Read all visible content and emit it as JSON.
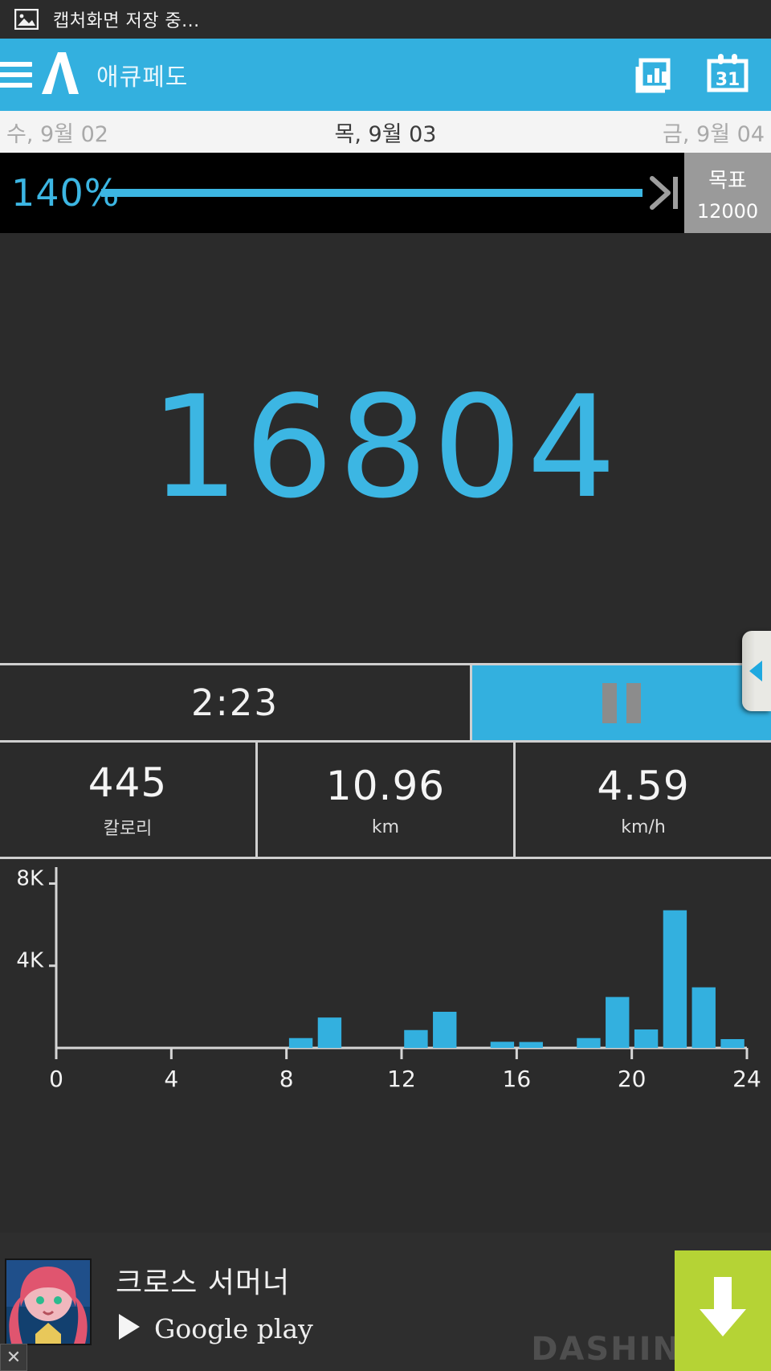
{
  "statusbar": {
    "text": "캡처화면 저장 중...",
    "icon": "image-icon"
  },
  "appbar": {
    "menu_icon": "hamburger-menu-icon",
    "logo": "accupedo-a-logo",
    "title": "애큐페도",
    "chart_icon": "bar-chart-history-icon",
    "calendar_icon": "calendar-icon",
    "calendar_day": "31",
    "accent_color": "#33b0df"
  },
  "dates": {
    "previous": "수, 9월 02",
    "current": "목, 9월 03",
    "next": "금, 9월 04"
  },
  "progress": {
    "percent_label": "140%",
    "percent_value": 140,
    "goal_label": "목표",
    "goal_value": "12000",
    "bar_color": "#3cb6e3",
    "bar_background": "#000000"
  },
  "hero": {
    "steps": "16804",
    "steps_color": "#3cb6e3"
  },
  "sidetab": {
    "icon": "expand-left-arrow-icon"
  },
  "timer": {
    "value": "2:23",
    "pause_icon": "pause-icon"
  },
  "stats": [
    {
      "value": "445",
      "label": "칼로리"
    },
    {
      "value": "10.96",
      "label": "km"
    },
    {
      "value": "4.59",
      "label": "km/h"
    }
  ],
  "chart_data": {
    "type": "bar",
    "title": "",
    "xlabel": "",
    "ylabel": "",
    "categories": [
      0,
      1,
      2,
      3,
      4,
      5,
      6,
      7,
      8,
      9,
      10,
      11,
      12,
      13,
      14,
      15,
      16,
      17,
      18,
      19,
      20,
      21,
      22,
      23
    ],
    "values": [
      0,
      0,
      0,
      0,
      0,
      0,
      0,
      0,
      480,
      1480,
      0,
      0,
      870,
      1760,
      0,
      300,
      290,
      0,
      480,
      2480,
      900,
      6700,
      2950,
      430
    ],
    "ytick_labels": [
      "4K",
      "8K"
    ],
    "ytick_values": [
      4000,
      8000
    ],
    "xtick_labels": [
      "0",
      "4",
      "8",
      "12",
      "16",
      "20",
      "24"
    ],
    "xtick_values": [
      0,
      4,
      8,
      12,
      16,
      20,
      24
    ],
    "ylim": [
      0,
      8800
    ],
    "xlim": [
      0,
      24
    ],
    "grid": false,
    "legend": false,
    "bar_color": "#33b0df",
    "axis_color": "#d6d6d6"
  },
  "ad": {
    "title": "크로스 서머너",
    "store": "Google play",
    "store_icon": "google-play-icon",
    "cta_icon": "download-arrow-icon",
    "watermark": "DASHIN",
    "close_label": "✕",
    "cta_color": "#b5d335"
  }
}
